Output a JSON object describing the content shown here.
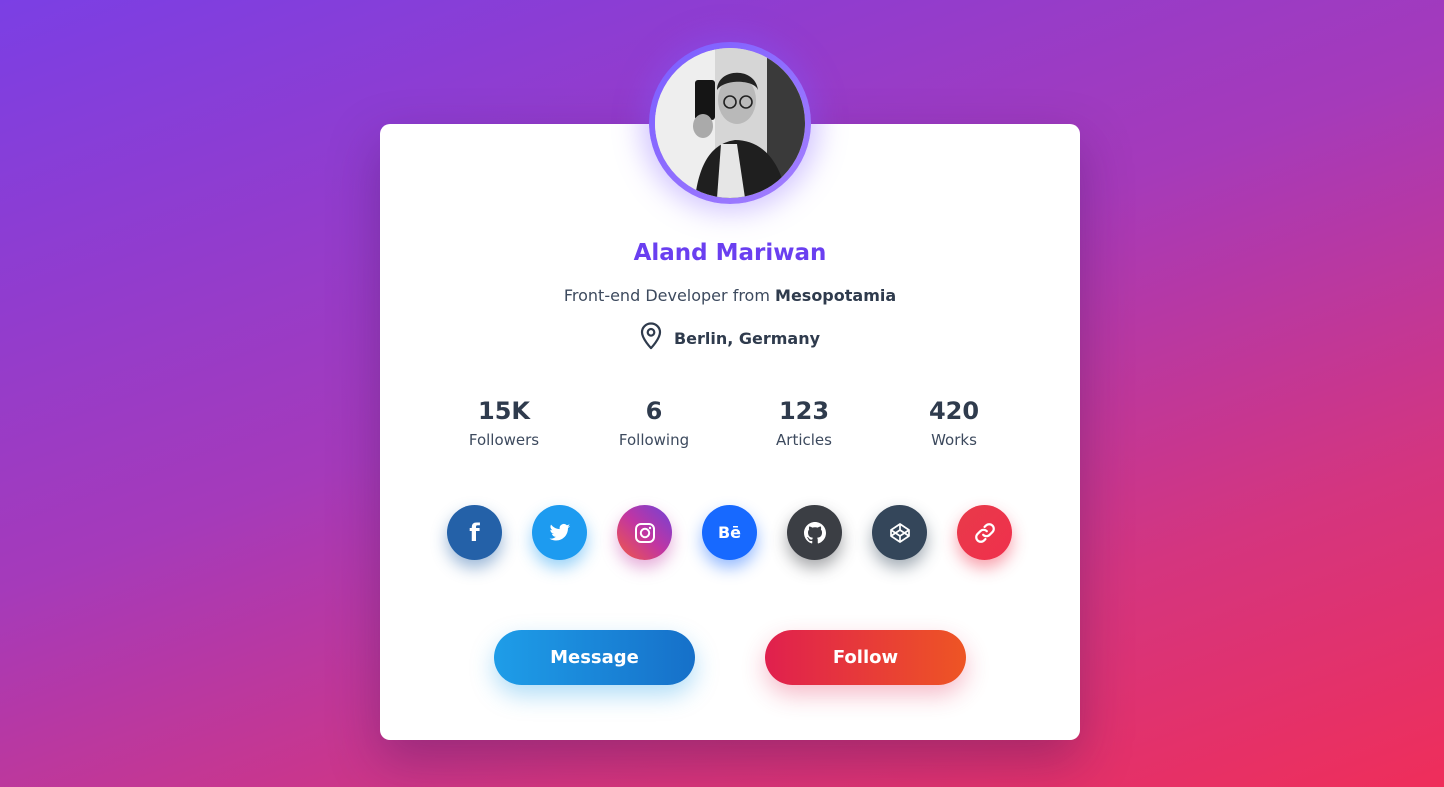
{
  "profile": {
    "name": "Aland Mariwan",
    "role_prefix": "Front-end Developer from ",
    "role_place": "Mesopotamia",
    "location": "Berlin, Germany",
    "location_icon": "map-pin-icon"
  },
  "stats": [
    {
      "value": "15K",
      "label": "Followers"
    },
    {
      "value": "6",
      "label": "Following"
    },
    {
      "value": "123",
      "label": "Articles"
    },
    {
      "value": "420",
      "label": "Works"
    }
  ],
  "socials": [
    {
      "icon": "facebook-icon",
      "glyph": "f",
      "color": "#2461a8"
    },
    {
      "icon": "twitter-icon",
      "color": "#1d9bf0"
    },
    {
      "icon": "instagram-icon",
      "color": "#c135a2"
    },
    {
      "icon": "behance-icon",
      "glyph": "Bē",
      "color": "#1769ff"
    },
    {
      "icon": "github-icon",
      "color": "#3b3e44"
    },
    {
      "icon": "codepen-icon",
      "color": "#34465a"
    },
    {
      "icon": "link-icon",
      "color": "#f0304c"
    }
  ],
  "actions": {
    "message_label": "Message",
    "follow_label": "Follow"
  },
  "colors": {
    "accent": "#6a3ff0",
    "message_button": "#1e9de8",
    "follow_button": "#e0204e"
  }
}
